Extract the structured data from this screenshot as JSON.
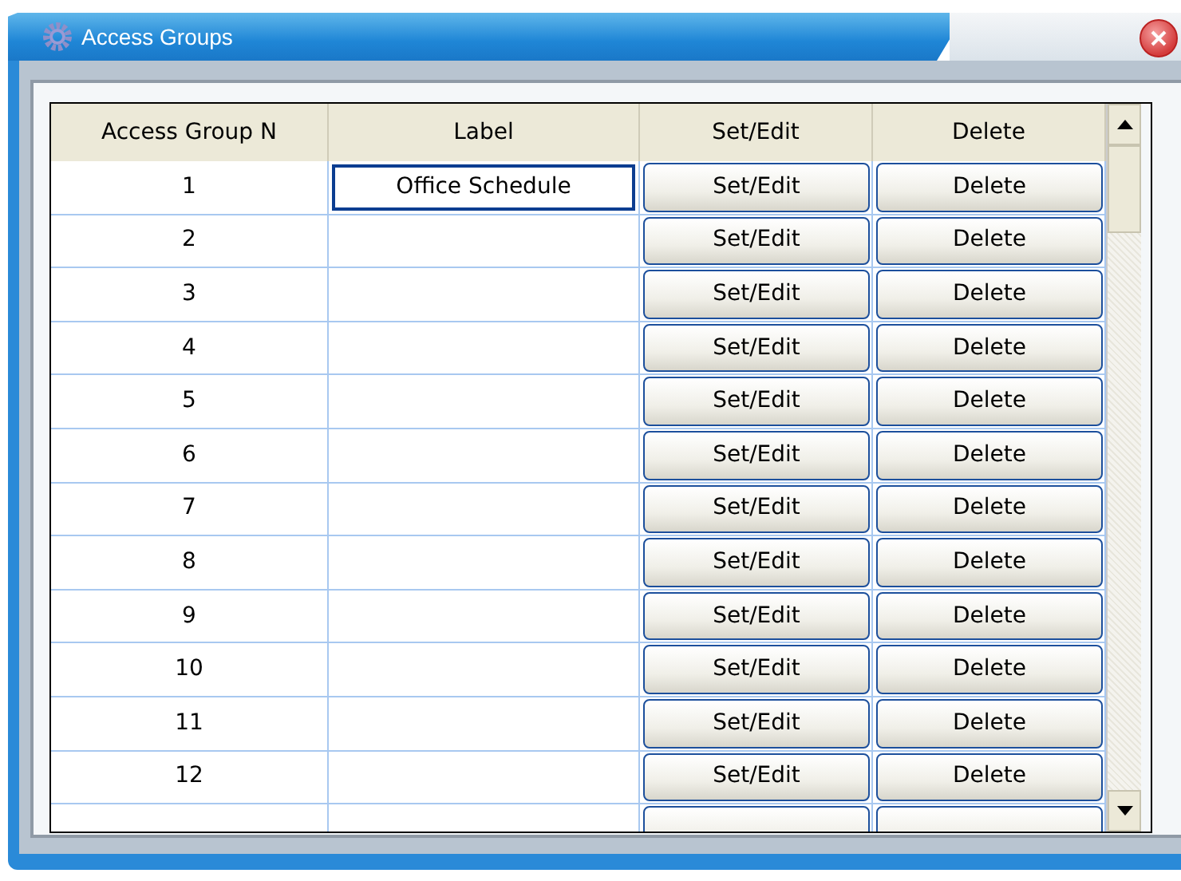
{
  "window": {
    "title": "Access Groups"
  },
  "table": {
    "columns": [
      "Access Group N",
      "Label",
      "Set/Edit",
      "Delete"
    ],
    "rows": [
      {
        "number": "1",
        "label": "Office Schedule",
        "label_focused": true,
        "set_edit": "Set/Edit",
        "delete": "Delete"
      },
      {
        "number": "2",
        "label_focused": false,
        "set_edit": "Set/Edit",
        "delete": "Delete"
      },
      {
        "number": "3",
        "label_focused": false,
        "set_edit": "Set/Edit",
        "delete": "Delete"
      },
      {
        "number": "4",
        "label_focused": false,
        "set_edit": "Set/Edit",
        "delete": "Delete"
      },
      {
        "number": "5",
        "label_focused": false,
        "set_edit": "Set/Edit",
        "delete": "Delete"
      },
      {
        "number": "6",
        "label_focused": false,
        "set_edit": "Set/Edit",
        "delete": "Delete"
      },
      {
        "number": "7",
        "label_focused": false,
        "set_edit": "Set/Edit",
        "delete": "Delete"
      },
      {
        "number": "8",
        "label_focused": false,
        "set_edit": "Set/Edit",
        "delete": "Delete"
      },
      {
        "number": "9",
        "label_focused": false,
        "set_edit": "Set/Edit",
        "delete": "Delete"
      },
      {
        "number": "10",
        "label_focused": false,
        "set_edit": "Set/Edit",
        "delete": "Delete"
      },
      {
        "number": "11",
        "label_focused": false,
        "set_edit": "Set/Edit",
        "delete": "Delete"
      },
      {
        "number": "12",
        "label_focused": false,
        "set_edit": "Set/Edit",
        "delete": "Delete"
      }
    ]
  }
}
